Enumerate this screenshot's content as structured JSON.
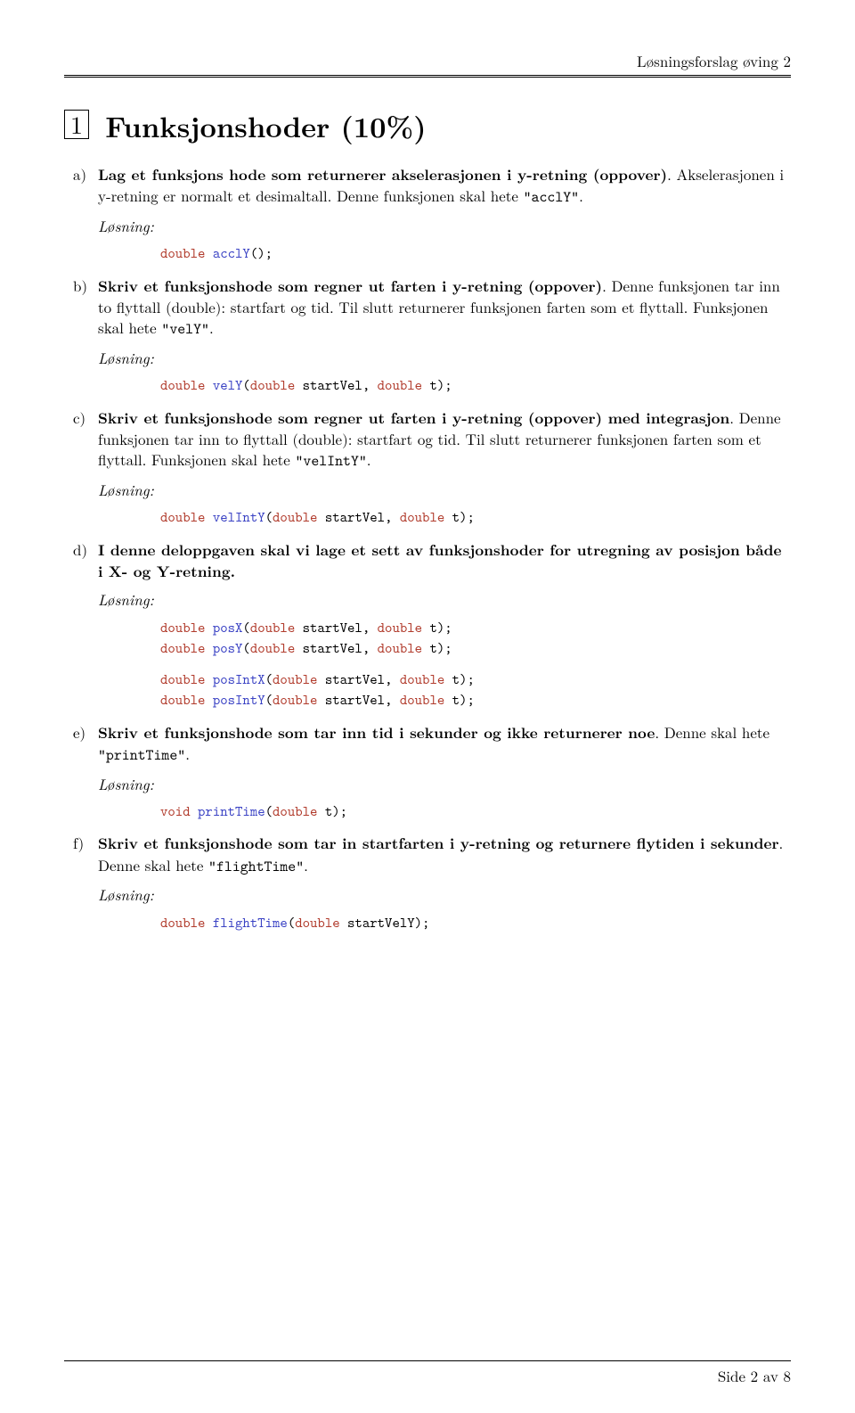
{
  "header": {
    "right": "Løsningsforslag øving 2"
  },
  "section": {
    "num": "1",
    "title": "Funksjonshoder (10%)"
  },
  "q": {
    "a": {
      "label": "a)",
      "body_bold": "Lag et funksjons hode som returnerer akselerasjonen i y-retning (oppover)",
      "body_rest1": ". Akselerasjonen i y-retning er normalt et desimaltall. Denne funksjonen skal hete ",
      "body_tt": "\"acclY\"",
      "body_rest2": ".",
      "solution": "Løsning:"
    },
    "b": {
      "label": "b)",
      "body_bold": "Skriv et funksjonshode som regner ut farten i y-retning (oppover)",
      "body_rest1": ". Denne funksjonen tar inn to flyttall (double): startfart og tid. Til slutt returnerer funksjonen farten som et flyttall. Funksjonen skal hete ",
      "body_tt": "\"velY\"",
      "body_rest2": ".",
      "solution": "Løsning:"
    },
    "c": {
      "label": "c)",
      "body_bold": "Skriv et funksjonshode som regner ut farten i y-retning (oppover) med integrasjon",
      "body_rest1": ". Denne funksjonen tar inn to flyttall (double): startfart og tid. Til slutt returnerer funksjonen farten som et flyttall. Funksjonen skal hete ",
      "body_tt": "\"velIntY\"",
      "body_rest2": ".",
      "solution": "Løsning:"
    },
    "d": {
      "label": "d)",
      "body_bold": "I denne deloppgaven skal vi lage et sett av funksjonshoder for utregning av posisjon både i X- og Y-retning.",
      "solution": "Løsning:"
    },
    "e": {
      "label": "e)",
      "body_bold": "Skriv et funksjonshode som tar inn tid i sekunder og ikke returnerer noe",
      "body_rest1": ". Denne skal hete ",
      "body_tt": "\"printTime\"",
      "body_rest2": ".",
      "solution": "Løsning:"
    },
    "f": {
      "label": "f)",
      "body_bold": "Skriv et funksjonshode som tar in startfarten i y-retning og returnere flytiden i sekunder",
      "body_rest1": ". Denne skal hete ",
      "body_tt": "\"flightTime\"",
      "body_rest2": ".",
      "solution": "Løsning:"
    }
  },
  "code": {
    "a": [
      {
        "type": "double",
        "fn": "acclY",
        "args": "();"
      }
    ],
    "b": [
      {
        "type": "double",
        "fn": "velY",
        "args_open": "(",
        "arg1t": "double",
        "arg1n": " startVel, ",
        "arg2t": "double",
        "arg2n": " t);"
      }
    ],
    "c": [
      {
        "type": "double",
        "fn": "velIntY",
        "args_open": "(",
        "arg1t": "double",
        "arg1n": " startVel, ",
        "arg2t": "double",
        "arg2n": " t);"
      }
    ],
    "d1": [
      {
        "type": "double",
        "fn": "posX",
        "args_open": "(",
        "arg1t": "double",
        "arg1n": " startVel, ",
        "arg2t": "double",
        "arg2n": " t);"
      },
      {
        "type": "double",
        "fn": "posY",
        "args_open": "(",
        "arg1t": "double",
        "arg1n": " startVel, ",
        "arg2t": "double",
        "arg2n": " t);"
      }
    ],
    "d2": [
      {
        "type": "double",
        "fn": "posIntX",
        "args_open": "(",
        "arg1t": "double",
        "arg1n": " startVel, ",
        "arg2t": "double",
        "arg2n": " t);"
      },
      {
        "type": "double",
        "fn": "posIntY",
        "args_open": "(",
        "arg1t": "double",
        "arg1n": " startVel, ",
        "arg2t": "double",
        "arg2n": " t);"
      }
    ],
    "e": [
      {
        "type": "void",
        "fn": "printTime",
        "args_open": "(",
        "arg1t": "double",
        "arg1n": " t);"
      }
    ],
    "f": [
      {
        "type": "double",
        "fn": "flightTime",
        "args_open": "(",
        "arg1t": "double",
        "arg1n": " startVelY);"
      }
    ]
  },
  "footer": {
    "text": "Side 2 av 8"
  }
}
